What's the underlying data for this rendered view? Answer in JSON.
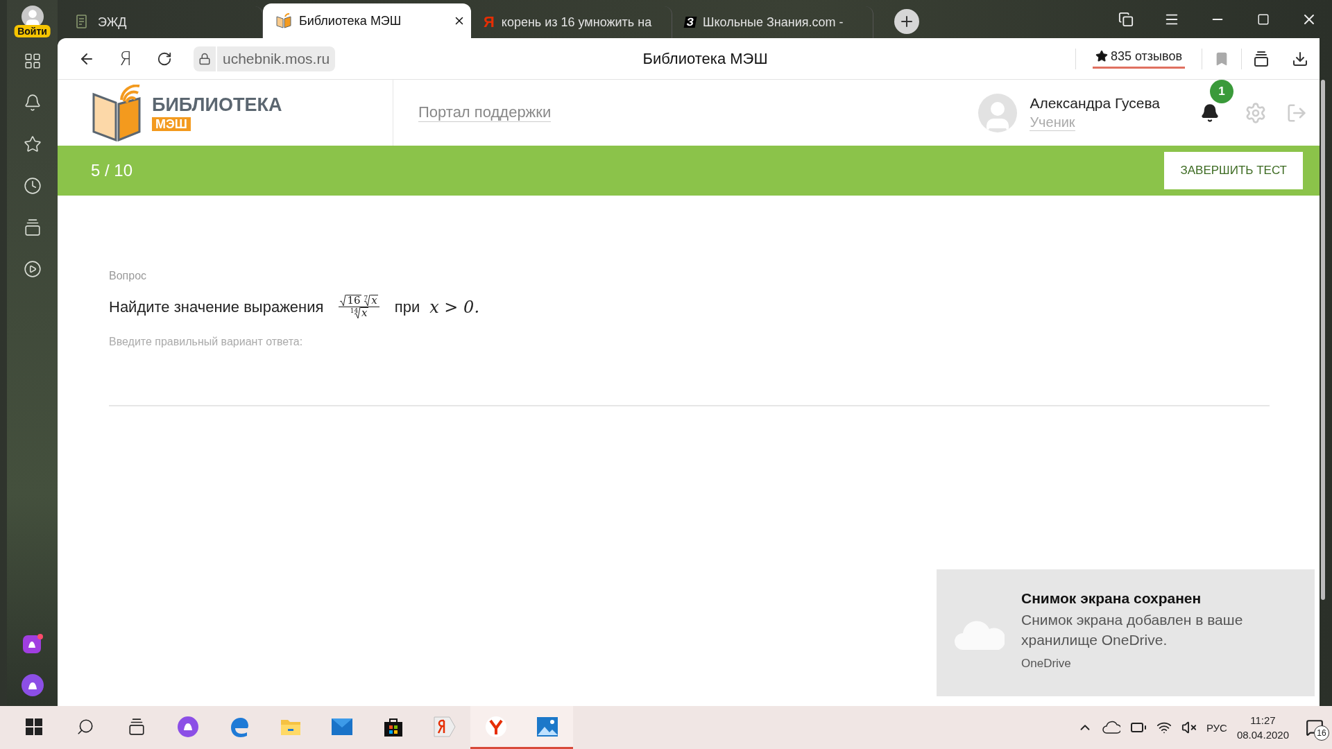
{
  "browser": {
    "profile_label": "Войти",
    "tabs": [
      {
        "kind": "doc",
        "title": "ЭЖД",
        "selected": false
      },
      {
        "kind": "book",
        "title": "Библиотека МЭШ",
        "selected": true
      },
      {
        "kind": "yandex",
        "icon_text": "Я",
        "title": "корень из 16 умножить на",
        "selected": false
      },
      {
        "kind": "znania",
        "icon_text": "З",
        "title": "Школьные Знания.com - ",
        "selected": false
      }
    ],
    "home_label": "Я",
    "url": "uchebnik.mos.ru",
    "page_title": "Библиотека МЭШ",
    "reviews": "835 отзывов"
  },
  "header": {
    "logo_title": "БИБЛИОТЕКА",
    "logo_badge": "МЭШ",
    "support_link": "Портал поддержки",
    "user_name": "Александра Гусева",
    "user_role": "Ученик",
    "notifications": "1"
  },
  "progress_bar": {
    "counter": "5 / 10",
    "finish_button": "ЗАВЕРШИТЬ ТЕСТ"
  },
  "question": {
    "label": "Вопрос",
    "prompt": "Найдите значение выражения",
    "formula": {
      "numerator": [
        {
          "radicand": "16"
        },
        {
          "index": "7",
          "radicand": "x"
        }
      ],
      "denominator": [
        {
          "index": "14",
          "radicand": "x"
        }
      ]
    },
    "connector": "при",
    "condition": "x > 0.",
    "answer_hint": "Введите правильный вариант ответа:"
  },
  "toast": {
    "title": "Снимок экрана сохранен",
    "message": "Снимок экрана добавлен в ваше хранилище OneDrive.",
    "source": "OneDrive"
  },
  "taskbar": {
    "apps": [
      {
        "kind": "alice",
        "active": false
      },
      {
        "kind": "edge",
        "active": false
      },
      {
        "kind": "explorer",
        "active": false
      },
      {
        "kind": "mail",
        "active": false
      },
      {
        "kind": "store",
        "active": false
      },
      {
        "kind": "yandex",
        "active": false
      },
      {
        "kind": "ybrowser",
        "active": true
      },
      {
        "kind": "photos",
        "active": true
      }
    ],
    "language": "РУС",
    "time": "11:27",
    "date": "08.04.2020",
    "notification_count": "16"
  }
}
